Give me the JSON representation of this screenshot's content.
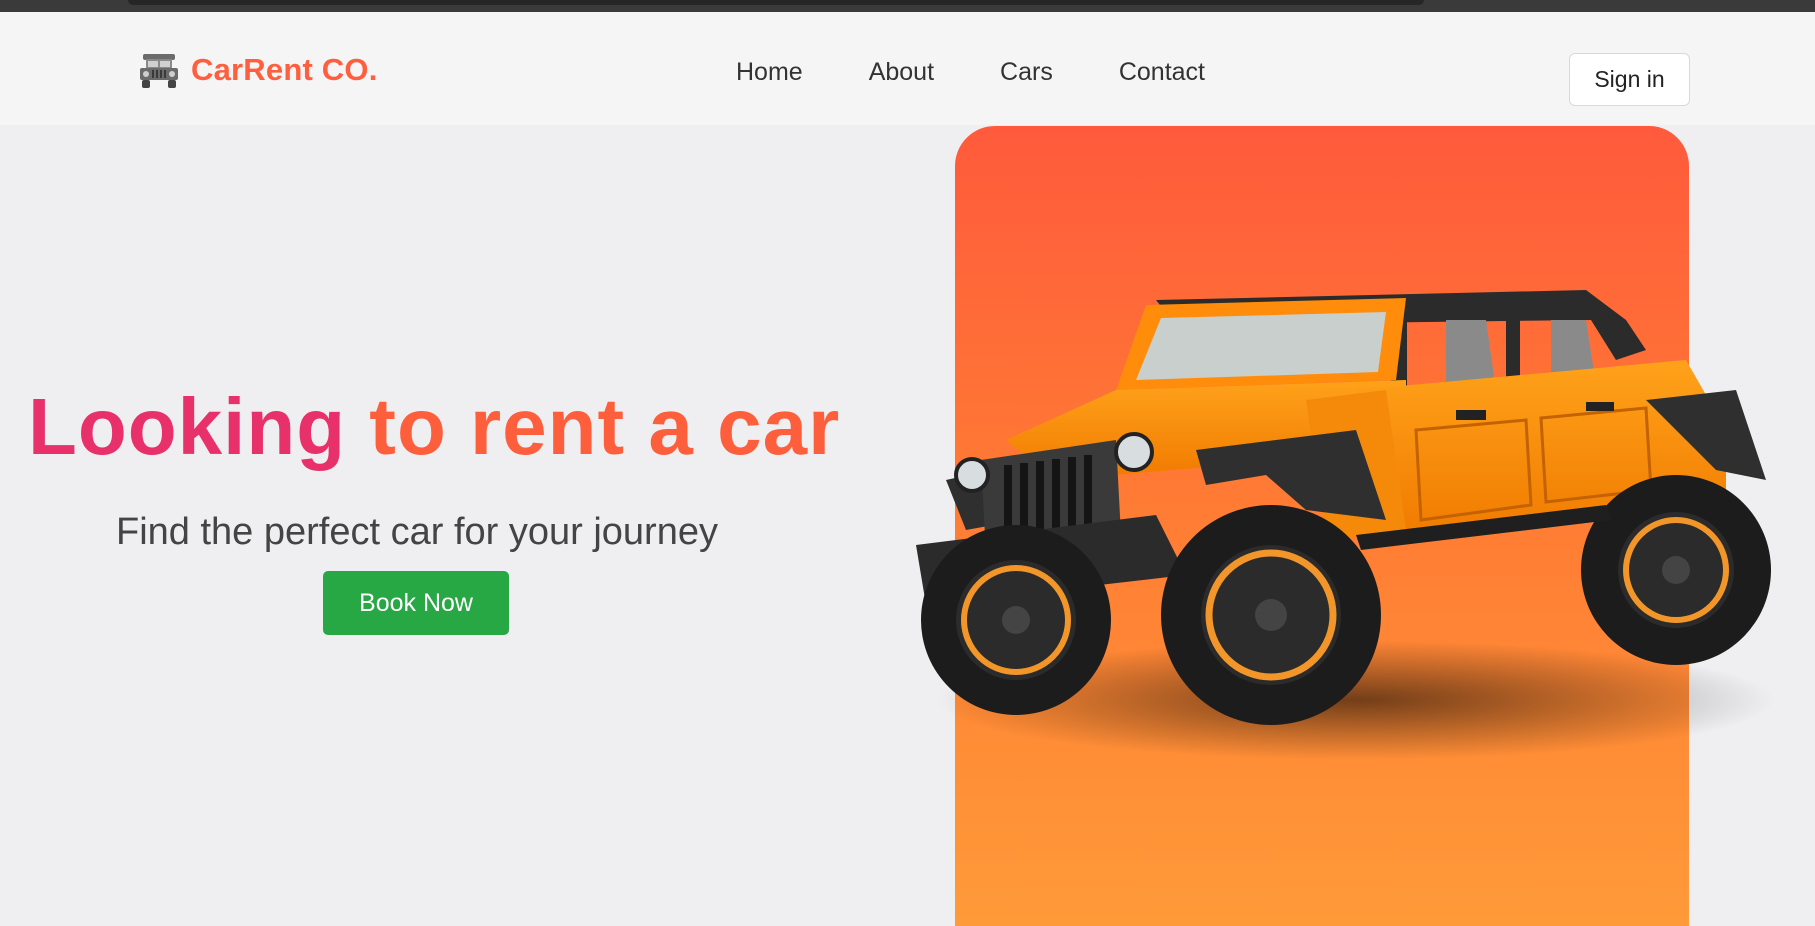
{
  "brand": {
    "name": "CarRent CO.",
    "color": "#fe5f3f",
    "icon": "jeep-icon"
  },
  "nav": {
    "links": [
      "Home",
      "About",
      "Cars",
      "Contact"
    ],
    "signin_label": "Sign in"
  },
  "hero": {
    "headline_part1": "Looking",
    "headline_part2": "to rent a car",
    "headline_colors": [
      "#e8306a",
      "#fd5f3d"
    ],
    "subtitle": "Find the perfect car for your journey",
    "cta_label": "Book Now",
    "cta_color": "#28a745",
    "image": "orange-jeep-image",
    "panel_gradient": [
      "#ff5a3c",
      "#ff9a38"
    ]
  }
}
